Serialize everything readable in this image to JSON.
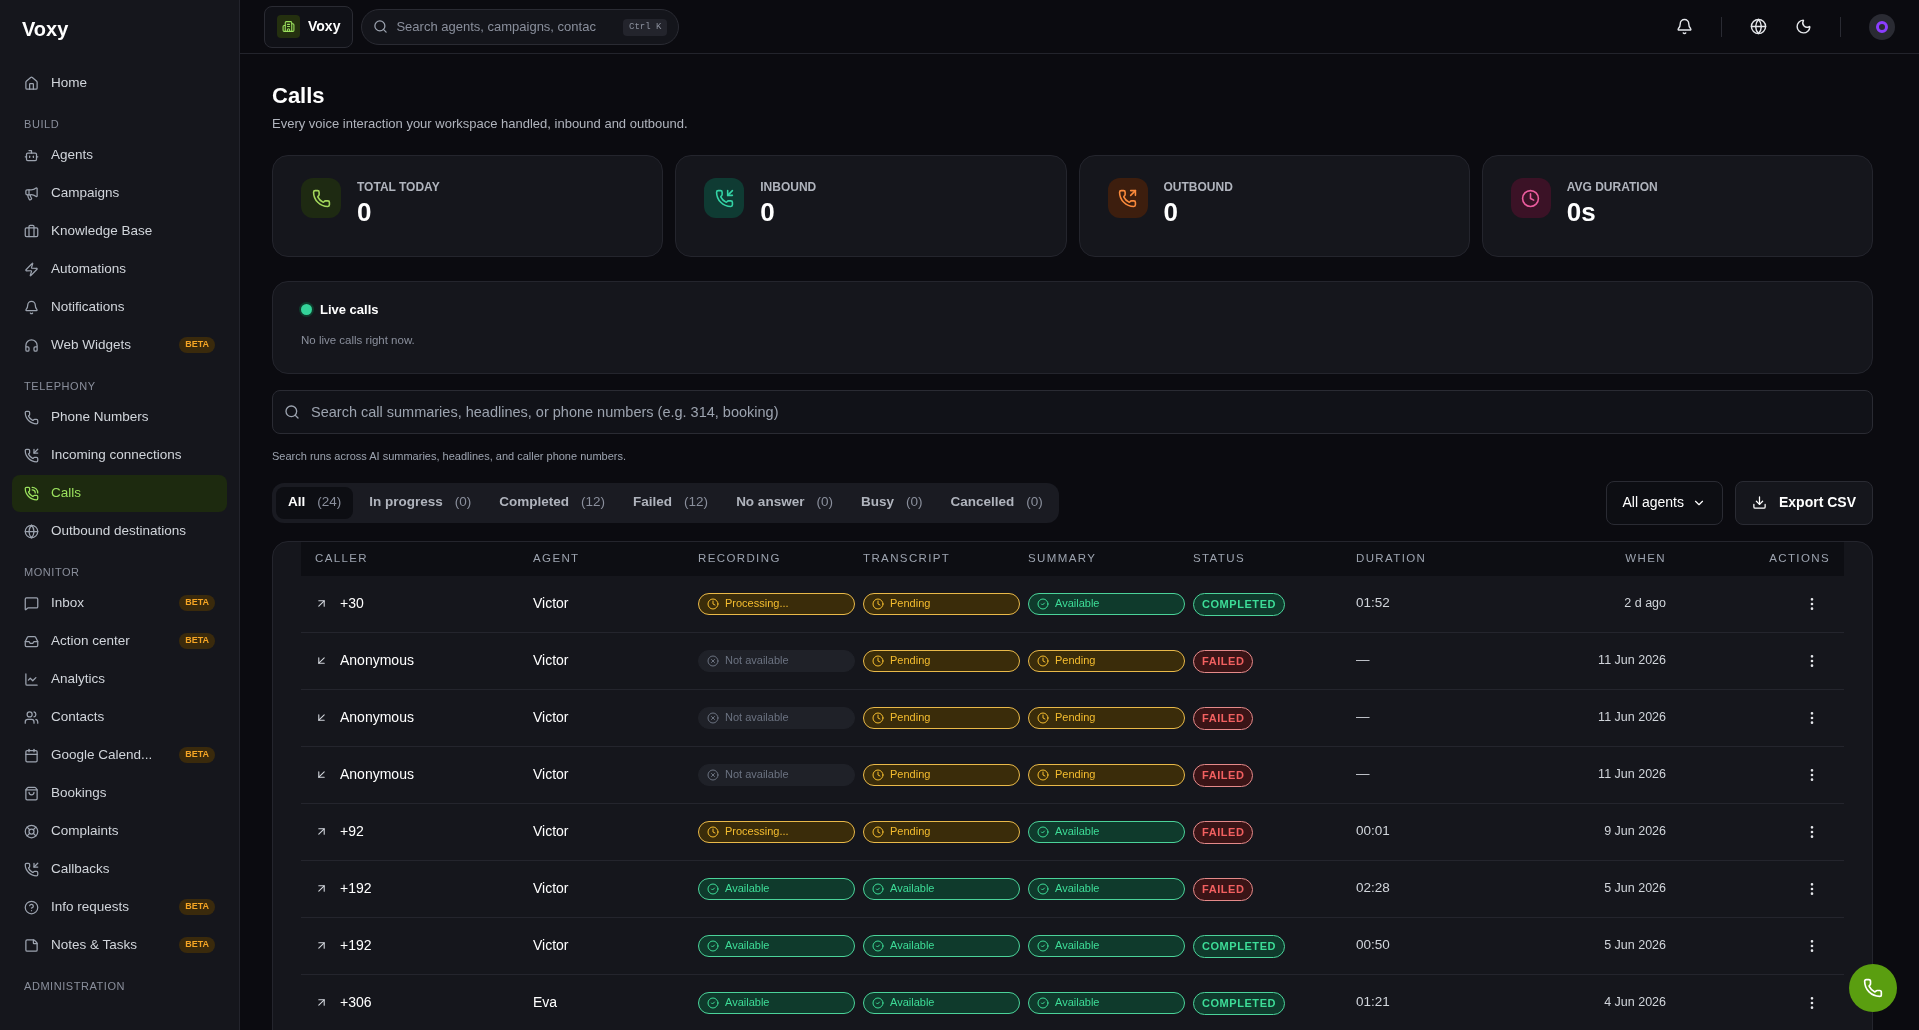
{
  "brand": "Voxy",
  "sidebar": {
    "sections": [
      {
        "items": [
          {
            "label": "Home",
            "selected": false
          }
        ]
      },
      {
        "title": "BUILD",
        "items": [
          {
            "label": "Agents",
            "selected": false
          },
          {
            "label": "Campaigns",
            "selected": false
          },
          {
            "label": "Knowledge Base",
            "selected": false
          },
          {
            "label": "Automations",
            "selected": false
          },
          {
            "label": "Notifications",
            "selected": false
          },
          {
            "label": "Web Widgets",
            "badge": "BETA",
            "selected": false
          }
        ]
      },
      {
        "title": "TELEPHONY",
        "items": [
          {
            "label": "Phone Numbers",
            "selected": false
          },
          {
            "label": "Incoming connections",
            "selected": false
          },
          {
            "label": "Calls",
            "selected": true
          },
          {
            "label": "Outbound destinations",
            "selected": false
          }
        ]
      },
      {
        "title": "MONITOR",
        "items": [
          {
            "label": "Inbox",
            "badge": "BETA",
            "selected": false
          },
          {
            "label": "Action center",
            "badge": "BETA",
            "selected": false
          },
          {
            "label": "Analytics",
            "selected": false
          },
          {
            "label": "Contacts",
            "selected": false
          },
          {
            "label": "Google Calend...",
            "badge": "BETA",
            "selected": false
          },
          {
            "label": "Bookings",
            "selected": false
          },
          {
            "label": "Complaints",
            "selected": false
          },
          {
            "label": "Callbacks",
            "selected": false
          },
          {
            "label": "Info requests",
            "badge": "BETA",
            "selected": false
          },
          {
            "label": "Notes & Tasks",
            "badge": "BETA",
            "selected": false
          }
        ]
      },
      {
        "title": "ADMINISTRATION"
      }
    ]
  },
  "topbar": {
    "workspace": "Voxy",
    "search_placeholder": "Search agents, campaigns, contac",
    "shortcut": "Ctrl K"
  },
  "page": {
    "title": "Calls",
    "subtitle": "Every voice interaction your workspace handled, inbound and outbound."
  },
  "stats": [
    {
      "label": "TOTAL TODAY",
      "value": "0",
      "kind": "total"
    },
    {
      "label": "INBOUND",
      "value": "0",
      "kind": "inbound"
    },
    {
      "label": "OUTBOUND",
      "value": "0",
      "kind": "outbound"
    },
    {
      "label": "AVG DURATION",
      "value": "0s",
      "kind": "duration"
    }
  ],
  "live_calls": {
    "title": "Live calls",
    "message": "No live calls right now."
  },
  "search": {
    "placeholder": "Search call summaries, headlines, or phone numbers (e.g. 314, booking)",
    "hint": "Search runs across AI summaries, headlines, and caller phone numbers."
  },
  "filters": [
    {
      "label": "All",
      "count": "(24)",
      "selected": true
    },
    {
      "label": "In progress",
      "count": "(0)",
      "selected": false
    },
    {
      "label": "Completed",
      "count": "(12)",
      "selected": false
    },
    {
      "label": "Failed",
      "count": "(12)",
      "selected": false
    },
    {
      "label": "No answer",
      "count": "(0)",
      "selected": false
    },
    {
      "label": "Busy",
      "count": "(0)",
      "selected": false
    },
    {
      "label": "Cancelled",
      "count": "(0)",
      "selected": false
    }
  ],
  "agent_filter": "All agents",
  "export": "Export CSV",
  "table": {
    "columns": [
      "CALLER",
      "AGENT",
      "RECORDING",
      "TRANSCRIPT",
      "SUMMARY",
      "STATUS",
      "DURATION",
      "WHEN",
      "ACTIONS"
    ],
    "rows": [
      {
        "kind": "outbound",
        "caller": "+30",
        "agent": "Victor",
        "recording": {
          "kind": "processing",
          "label": "Processing..."
        },
        "transcript": {
          "kind": "pending",
          "label": "Pending"
        },
        "summary": {
          "kind": "available",
          "label": "Available"
        },
        "status": {
          "kind": "completed",
          "label": "COMPLETED"
        },
        "duration": "01:52",
        "when": "2 d ago"
      },
      {
        "kind": "inbound",
        "caller": "Anonymous",
        "agent": "Victor",
        "recording": {
          "kind": "not_available",
          "label": "Not available"
        },
        "transcript": {
          "kind": "pending",
          "label": "Pending"
        },
        "summary": {
          "kind": "pending",
          "label": "Pending"
        },
        "status": {
          "kind": "failed",
          "label": "FAILED"
        },
        "duration": "—",
        "when": "11 Jun 2026"
      },
      {
        "kind": "inbound",
        "caller": "Anonymous",
        "agent": "Victor",
        "recording": {
          "kind": "not_available",
          "label": "Not available"
        },
        "transcript": {
          "kind": "pending",
          "label": "Pending"
        },
        "summary": {
          "kind": "pending",
          "label": "Pending"
        },
        "status": {
          "kind": "failed",
          "label": "FAILED"
        },
        "duration": "—",
        "when": "11 Jun 2026"
      },
      {
        "kind": "inbound",
        "caller": "Anonymous",
        "agent": "Victor",
        "recording": {
          "kind": "not_available",
          "label": "Not available"
        },
        "transcript": {
          "kind": "pending",
          "label": "Pending"
        },
        "summary": {
          "kind": "pending",
          "label": "Pending"
        },
        "status": {
          "kind": "failed",
          "label": "FAILED"
        },
        "duration": "—",
        "when": "11 Jun 2026"
      },
      {
        "kind": "outbound",
        "caller": "+92",
        "agent": "Victor",
        "recording": {
          "kind": "processing",
          "label": "Processing..."
        },
        "transcript": {
          "kind": "pending",
          "label": "Pending"
        },
        "summary": {
          "kind": "available",
          "label": "Available"
        },
        "status": {
          "kind": "failed",
          "label": "FAILED"
        },
        "duration": "00:01",
        "when": "9 Jun 2026"
      },
      {
        "kind": "outbound",
        "caller": "+192",
        "agent": "Victor",
        "recording": {
          "kind": "available",
          "label": "Available"
        },
        "transcript": {
          "kind": "available",
          "label": "Available"
        },
        "summary": {
          "kind": "available",
          "label": "Available"
        },
        "status": {
          "kind": "failed",
          "label": "FAILED"
        },
        "duration": "02:28",
        "when": "5 Jun 2026"
      },
      {
        "kind": "outbound",
        "caller": "+192",
        "agent": "Victor",
        "recording": {
          "kind": "available",
          "label": "Available"
        },
        "transcript": {
          "kind": "available",
          "label": "Available"
        },
        "summary": {
          "kind": "available",
          "label": "Available"
        },
        "status": {
          "kind": "completed",
          "label": "COMPLETED"
        },
        "duration": "00:50",
        "when": "5 Jun 2026"
      },
      {
        "kind": "outbound",
        "caller": "+306",
        "agent": "Eva",
        "recording": {
          "kind": "available",
          "label": "Available"
        },
        "transcript": {
          "kind": "available",
          "label": "Available"
        },
        "summary": {
          "kind": "available",
          "label": "Available"
        },
        "status": {
          "kind": "completed",
          "label": "COMPLETED"
        },
        "duration": "01:21",
        "when": "4 Jun 2026"
      }
    ]
  }
}
